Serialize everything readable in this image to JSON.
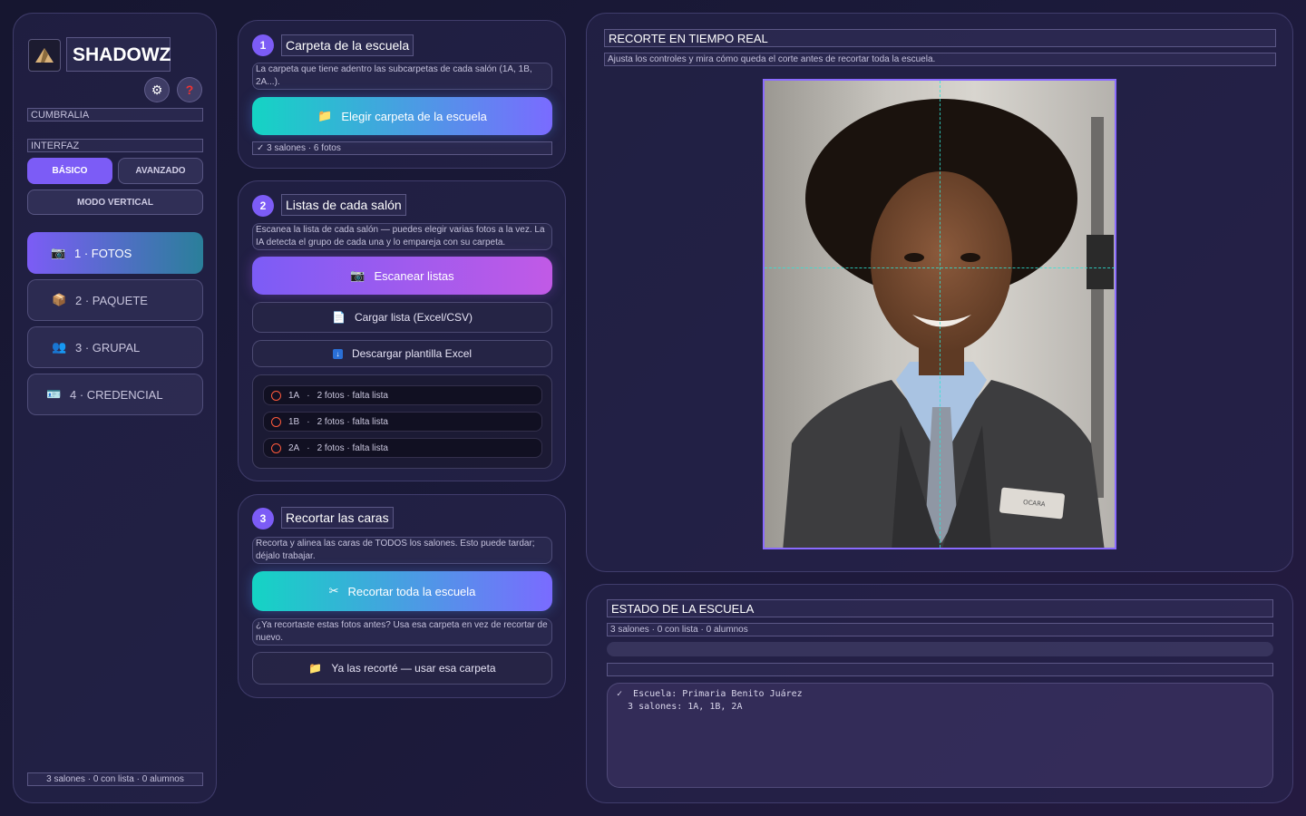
{
  "sidebar": {
    "app_name": "SHADOWZ",
    "umbral_label": "CUMBRALIA",
    "interfaz_label": "INTERFAZ",
    "basic_label": "BÁSICO",
    "advanced_label": "AVANZADO",
    "vertical_label": "MODO VERTICAL",
    "nav": [
      {
        "icon": "📷",
        "label": "1 · FOTOS"
      },
      {
        "icon": "📦",
        "label": "2 · PAQUETE"
      },
      {
        "icon": "👥",
        "label": "3 · GRUPAL"
      },
      {
        "icon": "🪪",
        "label": "4 · CREDENCIAL"
      }
    ],
    "footer": "3 salones · 0 con lista · 0 alumnos"
  },
  "step1": {
    "num": "1",
    "title": "Carpeta de la escuela",
    "desc": "La carpeta que tiene adentro las subcarpetas de cada salón (1A, 1B, 2A...).",
    "button": "Elegir carpeta de la escuela",
    "status": "✓ 3 salones · 6 fotos"
  },
  "step2": {
    "num": "2",
    "title": "Listas de cada salón",
    "desc": "Escanea la lista de cada salón — puedes elegir varias fotos a la vez. La IA detecta el grupo de cada una y lo empareja con su carpeta.",
    "scan_button": "Escanear listas",
    "load_button": "Cargar lista (Excel/CSV)",
    "template_button": "Descargar plantilla Excel",
    "salones": [
      {
        "name": "1A",
        "info": "2 fotos · falta lista"
      },
      {
        "name": "1B",
        "info": "2 fotos · falta lista"
      },
      {
        "name": "2A",
        "info": "2 fotos · falta lista"
      }
    ],
    "separator": "·"
  },
  "step3": {
    "num": "3",
    "title": "Recortar las caras",
    "desc": "Recorta y alinea las caras de TODOS los salones. Esto puede tardar; déjalo trabajar.",
    "button": "Recortar toda la escuela",
    "desc2": "¿Ya recortaste estas fotos antes? Usa esa carpeta en vez de recortar de nuevo.",
    "reuse_button": "Ya las recorté — usar esa carpeta"
  },
  "preview": {
    "title": "RECORTE EN TIEMPO REAL",
    "subtitle": "Ajusta los controles y mira cómo queda el corte antes de recortar toda la escuela.",
    "badge_text": "OCARA"
  },
  "estado": {
    "title": "ESTADO DE LA ESCUELA",
    "subtitle": "3 salones · 0 con lista · 0 alumnos",
    "log": "✓  Escuela: Primaria Benito Juárez\n  3 salones: 1A, 1B, 2A"
  },
  "colors": {
    "accent": "#7c5cf6",
    "teal": "#14d4c4",
    "error": "#ff5a3c"
  }
}
